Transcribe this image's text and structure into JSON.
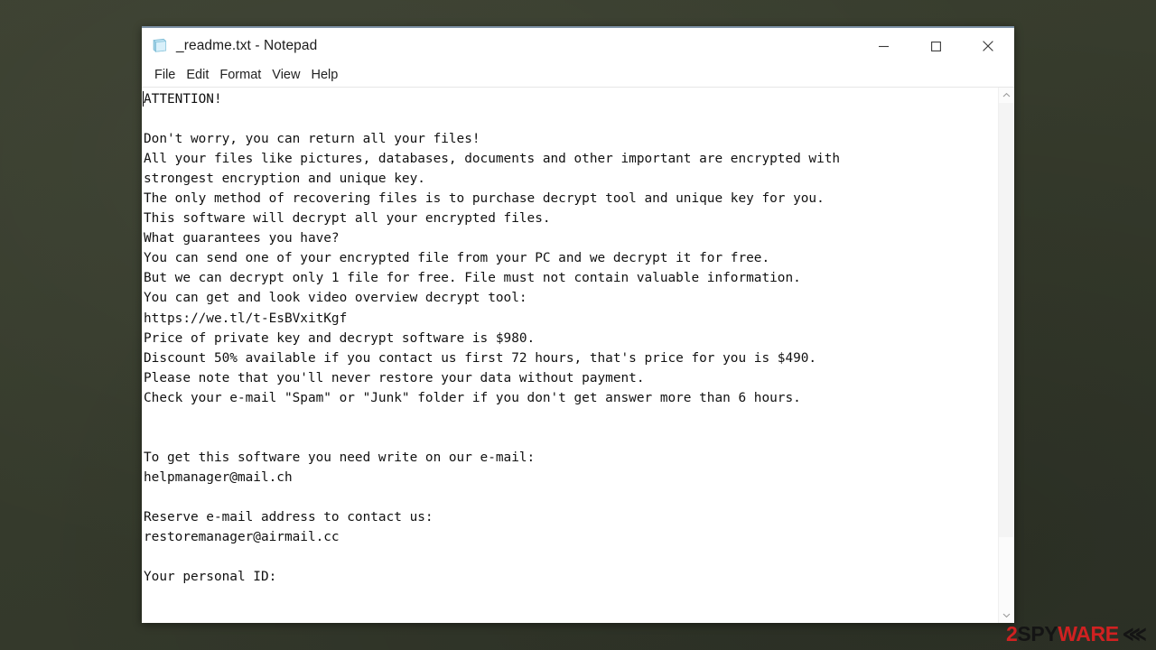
{
  "desktop": {
    "background_color": "#373c2d"
  },
  "window": {
    "title": "_readme.txt - Notepad",
    "icon": "notepad-document-icon",
    "controls": {
      "minimize_label": "Minimize",
      "maximize_label": "Maximize",
      "close_label": "Close"
    },
    "menu": [
      {
        "label": "File"
      },
      {
        "label": "Edit"
      },
      {
        "label": "Format"
      },
      {
        "label": "View"
      },
      {
        "label": "Help"
      }
    ],
    "scrollbar": {
      "up_arrow": "chevron-up-icon",
      "down_arrow": "chevron-down-icon",
      "thumb_position": "top"
    }
  },
  "document": {
    "filename": "_readme.txt",
    "lines": [
      "ATTENTION!",
      "",
      "Don't worry, you can return all your files!",
      "All your files like pictures, databases, documents and other important are encrypted with",
      "strongest encryption and unique key.",
      "The only method of recovering files is to purchase decrypt tool and unique key for you.",
      "This software will decrypt all your encrypted files.",
      "What guarantees you have?",
      "You can send one of your encrypted file from your PC and we decrypt it for free.",
      "But we can decrypt only 1 file for free. File must not contain valuable information.",
      "You can get and look video overview decrypt tool:",
      "https://we.tl/t-EsBVxitKgf",
      "Price of private key and decrypt software is $980.",
      "Discount 50% available if you contact us first 72 hours, that's price for you is $490.",
      "Please note that you'll never restore your data without payment.",
      "Check your e-mail \"Spam\" or \"Junk\" folder if you don't get answer more than 6 hours.",
      "",
      "",
      "To get this software you need write on our e-mail:",
      "helpmanager@mail.ch",
      "",
      "Reserve e-mail address to contact us:",
      "restoremanager@airmail.cc",
      "",
      "Your personal ID:"
    ],
    "text": "ATTENTION!\n\nDon't worry, you can return all your files!\nAll your files like pictures, databases, documents and other important are encrypted with\nstrongest encryption and unique key.\nThe only method of recovering files is to purchase decrypt tool and unique key for you.\nThis software will decrypt all your encrypted files.\nWhat guarantees you have?\nYou can send one of your encrypted file from your PC and we decrypt it for free.\nBut we can decrypt only 1 file for free. File must not contain valuable information.\nYou can get and look video overview decrypt tool:\nhttps://we.tl/t-EsBVxitKgf\nPrice of private key and decrypt software is $980.\nDiscount 50% available if you contact us first 72 hours, that's price for you is $490.\nPlease note that you'll never restore your data without payment.\nCheck your e-mail \"Spam\" or \"Junk\" folder if you don't get answer more than 6 hours.\n\n\nTo get this software you need write on our e-mail:\nhelpmanager@mail.ch\n\nReserve e-mail address to contact us:\nrestoremanager@airmail.cc\n\nYour personal ID:",
    "details": {
      "download_url": "https://we.tl/t-EsBVxitKgf",
      "price": "$980",
      "discount_price": "$490",
      "discount_percent": "50%",
      "discount_window_hours": "72",
      "response_time_hours": "6",
      "free_decrypt_file_count": "1",
      "primary_email": "helpmanager@mail.ch",
      "reserve_email": "restoremanager@airmail.cc"
    }
  },
  "watermark": {
    "part_1": "2",
    "part_2": "SPY",
    "part_3": "WAR",
    "part_4": "E",
    "chevrons": "⋘",
    "color_red": "#d62121",
    "color_black": "#141414"
  }
}
